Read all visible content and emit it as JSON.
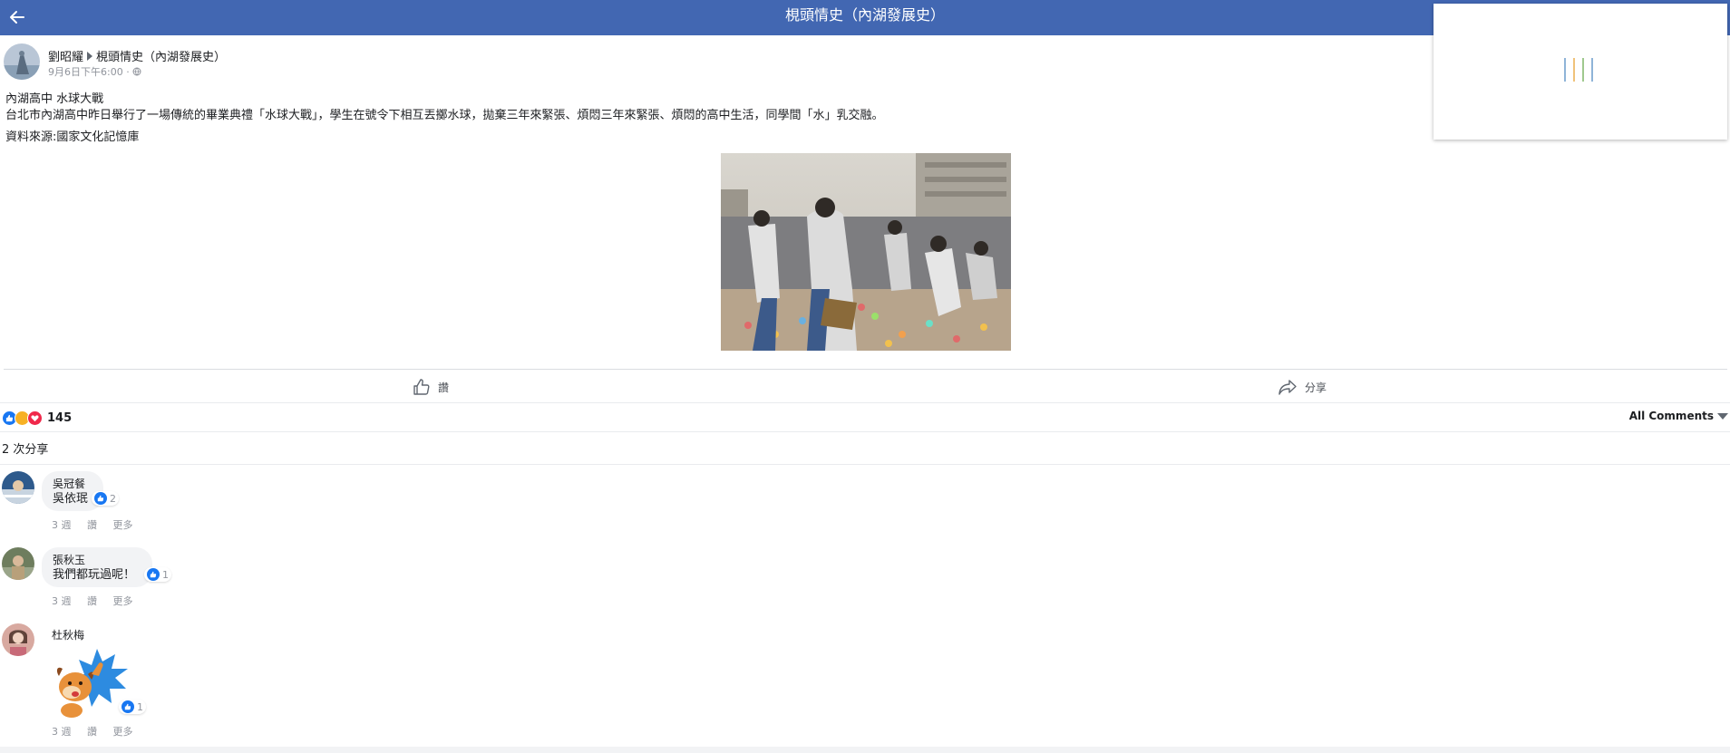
{
  "header": {
    "title": "梘頭情史（內湖發展史）",
    "background": "#4267b2"
  },
  "post": {
    "author": "劉昭耀",
    "group": "梘頭情史（內湖發展史）",
    "timestamp": "9月6日下午6:00 ·",
    "privacy_icon": "globe-icon",
    "text_lines": [
      "內湖高中 水球大戰",
      "台北市內湖高中昨日舉行了一場傳統的畢業典禮「水球大戰」，學生在號令下相互丟擲水球，拋棄三年來緊張、煩悶三年來緊張、煩悶的高中生活，同學間「水」乳交融。"
    ],
    "source": "資料來源:國家文化記憶庫"
  },
  "actions": {
    "like_label": "讚",
    "share_label": "分享"
  },
  "reactions": {
    "icons": [
      "like-icon",
      "haha-icon",
      "love-icon"
    ],
    "count": "145",
    "filter_label": "All Comments"
  },
  "shares": {
    "label": "2 次分享"
  },
  "comments": [
    {
      "name": "吳冠餐",
      "text": "吳依珉",
      "likes": "2",
      "time": "3 週",
      "like": "讚",
      "more": "更多"
    },
    {
      "name": "張秋玉",
      "text": "我們都玩過呢！",
      "likes": "1",
      "time": "3 週",
      "like": "讚",
      "more": "更多"
    },
    {
      "name": "杜秋梅",
      "text": "",
      "likes": "1",
      "time": "3 週",
      "like": "讚",
      "more": "更多"
    }
  ],
  "colors": {
    "accent": "#4267b2",
    "like_blue": "#1877f2",
    "muted": "#90949c"
  }
}
